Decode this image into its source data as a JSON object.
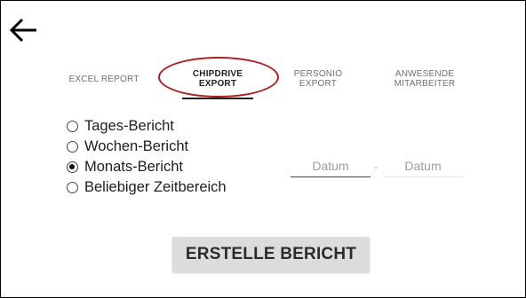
{
  "header": {
    "back_icon": "arrow-left-icon"
  },
  "tabs": [
    {
      "label": "EXCEL REPORT"
    },
    {
      "label_line1": "CHIPDRIVE",
      "label_line2": "EXPORT",
      "active": true
    },
    {
      "label_line1": "PERSONIO",
      "label_line2": "EXPORT"
    },
    {
      "label_line1": "ANWESENDE",
      "label_line2": "MITARBEITER"
    }
  ],
  "annotation": {
    "color": "#b01c1c"
  },
  "report_types": [
    {
      "label": "Tages-Bericht",
      "checked": false
    },
    {
      "label": "Wochen-Bericht",
      "checked": false
    },
    {
      "label": "Monats-Bericht",
      "checked": true
    },
    {
      "label": "Beliebiger Zeitbereich",
      "checked": false
    }
  ],
  "date_range": {
    "from_placeholder": "Datum",
    "separator": "-",
    "to_placeholder": "Datum"
  },
  "action": {
    "create_report_label": "ERSTELLE BERICHT"
  }
}
